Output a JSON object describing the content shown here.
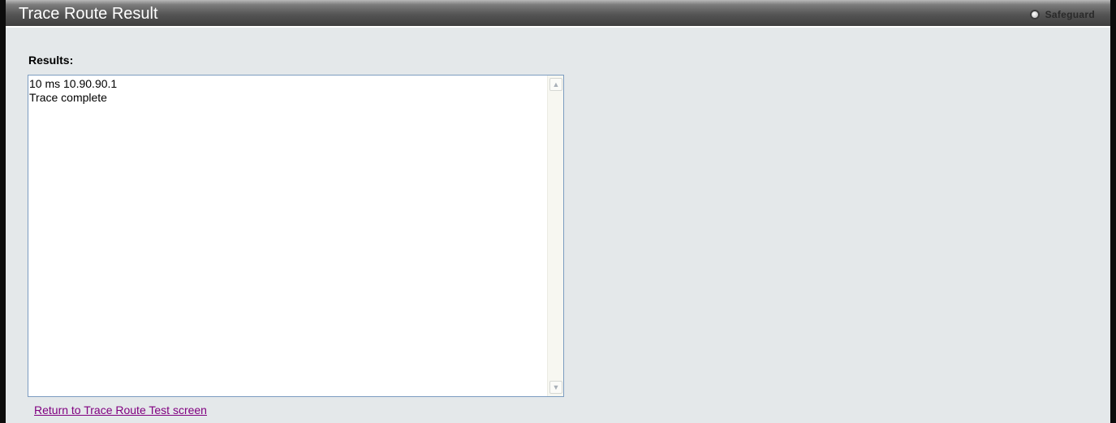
{
  "page": {
    "title": "Trace Route Result",
    "safeguard_label": "Safeguard"
  },
  "results": {
    "label": "Results:",
    "lines": [
      "10 ms 10.90.90.1",
      "Trace complete"
    ]
  },
  "link": {
    "return_label": "Return to Trace Route Test screen"
  },
  "icons": {
    "safeguard": "safeguard-indicator-icon",
    "scroll_up": "chevron-up-icon",
    "scroll_down": "chevron-down-icon"
  },
  "colors": {
    "title_bar": "#555555",
    "panel_background": "#e4e8ea",
    "visited_link": "#800080",
    "textarea_border": "#7c9cc0"
  }
}
